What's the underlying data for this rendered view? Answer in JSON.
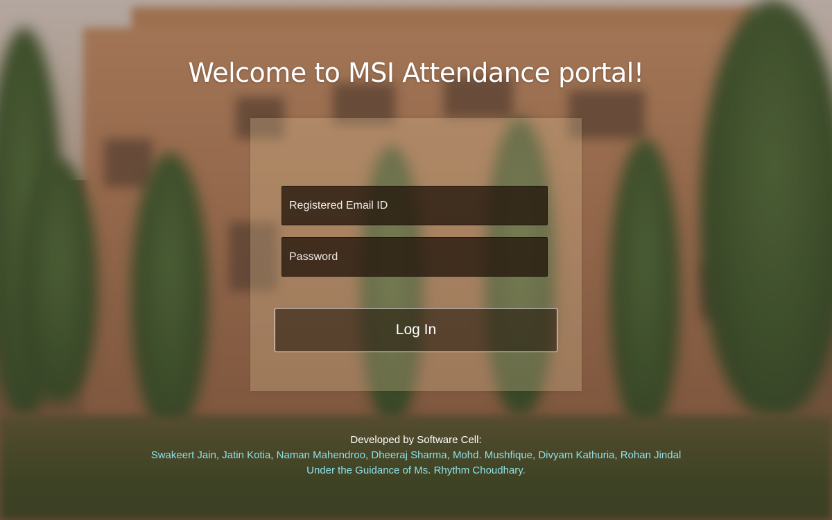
{
  "header": {
    "title": "Welcome to MSI Attendance portal!"
  },
  "login_form": {
    "email_placeholder": "Registered Email ID",
    "email_value": "",
    "password_placeholder": "Password",
    "password_value": "",
    "login_label": "Log In"
  },
  "footer": {
    "developed_by": "Developed by Software Cell:",
    "names": "Swakeert Jain, Jatin Kotia, Naman Mahendroo, Dheeraj Sharma, Mohd. Mushfique, Divyam Kathuria, Rohan Jindal",
    "guidance": "Under the Guidance of Ms. Rhythm Choudhary."
  },
  "colors": {
    "footer_accent": "#8fe0e6",
    "title_text": "#ffffff"
  }
}
